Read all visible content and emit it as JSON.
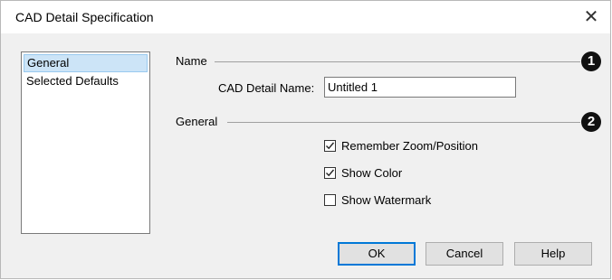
{
  "window": {
    "title": "CAD Detail Specification",
    "close_glyph": "✕"
  },
  "sidebar": {
    "items": [
      {
        "label": "General",
        "selected": true
      },
      {
        "label": "Selected Defaults",
        "selected": false
      }
    ]
  },
  "name_section": {
    "heading": "Name",
    "badge": "1",
    "field_label": "CAD Detail Name:",
    "field_value": "Untitled 1"
  },
  "general_section": {
    "heading": "General",
    "badge": "2",
    "options": [
      {
        "label": "Remember Zoom/Position",
        "checked": true
      },
      {
        "label": "Show Color",
        "checked": true
      },
      {
        "label": "Show Watermark",
        "checked": false
      }
    ]
  },
  "buttons": {
    "ok": "OK",
    "cancel": "Cancel",
    "help": "Help"
  }
}
